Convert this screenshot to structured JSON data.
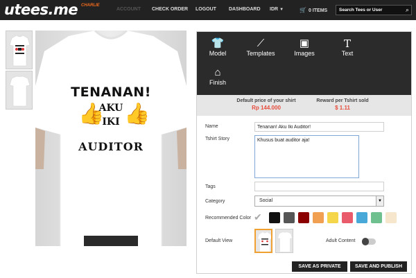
{
  "header": {
    "logo": "utees.me",
    "username": "CHARLIE",
    "nav": {
      "faded": "ACCOUNT",
      "checkout": "CHECK ORDER",
      "logout": "LOGOUT",
      "dashboard": "DASHBOARD",
      "currency": "IDR",
      "cart": "0 ITEMS"
    },
    "search": {
      "placeholder": "Search Tees or User"
    }
  },
  "preview": {
    "design": {
      "line1": "TENANAN!",
      "aku": "AKU",
      "iki": "IKI",
      "line3": "AUDITOR"
    }
  },
  "toolbar": {
    "model": "Model",
    "templates": "Templates",
    "images": "Images",
    "text": "Text",
    "finish": "Finish"
  },
  "prices": {
    "default_label": "Default price of your shirt",
    "default_value": "Rp 144.000",
    "reward_label": "Reward per Tshirt sold",
    "reward_value": "$ 1.11"
  },
  "form": {
    "name_label": "Name",
    "name_value": "Tenanan! Aku Iki Auditor!",
    "story_label": "Tshirt Story",
    "story_value": "Khusus buat auditor aja!",
    "tags_label": "Tags",
    "tags_value": "",
    "category_label": "Category",
    "category_value": "Social",
    "color_label": "Recommended Color",
    "colors": [
      "#111111",
      "#555555",
      "#8b0000",
      "#f0a050",
      "#f5d54a",
      "#e95a6a",
      "#48a9d8",
      "#6fc08f",
      "#f5e6cc"
    ],
    "view_label": "Default View",
    "adult_label": "Adult Content"
  },
  "actions": {
    "save_private": "SAVE AS PRIVATE",
    "save_publish": "SAVE AND PUBLISH"
  }
}
